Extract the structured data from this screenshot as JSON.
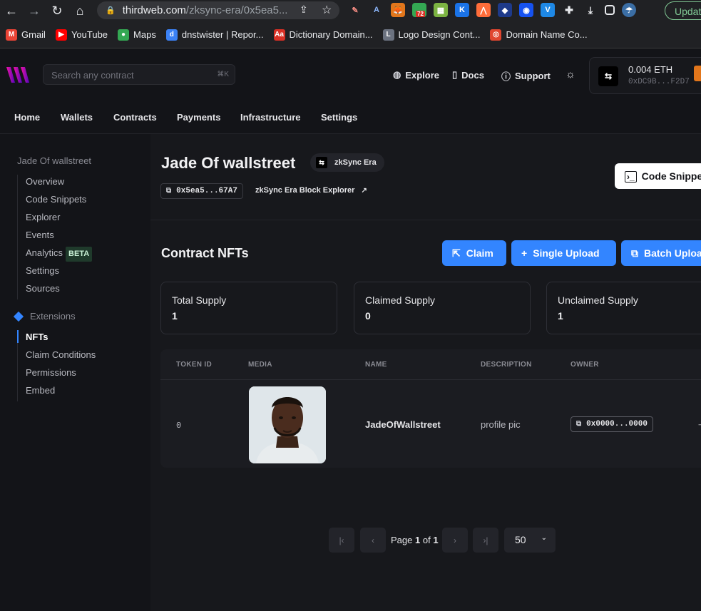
{
  "browser": {
    "url_host": "thirdweb.com",
    "url_path": "/zksync-era/0x5ea5...",
    "update_label": "Update",
    "extension_badge": "72",
    "bookmarks": [
      {
        "label": "Gmail",
        "color": "#ea4335",
        "glyph": "M"
      },
      {
        "label": "YouTube",
        "color": "#ff0000",
        "glyph": "▶"
      },
      {
        "label": "Maps",
        "color": "#34a853",
        "glyph": "●"
      },
      {
        "label": "dnstwister | Repor...",
        "color": "#3b82f6",
        "glyph": "d"
      },
      {
        "label": "Dictionary Domain...",
        "color": "#d93025",
        "glyph": "Aa"
      },
      {
        "label": "Logo Design Cont...",
        "color": "#6b7280",
        "glyph": "L"
      },
      {
        "label": "Domain Name Co...",
        "color": "#e0462f",
        "glyph": "◎"
      }
    ]
  },
  "header": {
    "search_placeholder": "Search any contract",
    "search_shortcut": "⌘K",
    "explore": "Explore",
    "docs": "Docs",
    "support": "Support",
    "wallet_balance": "0.004 ETH",
    "wallet_address": "0xDC9B...F2D7",
    "wallet_chain_glyph": "⇆"
  },
  "nav": [
    "Home",
    "Wallets",
    "Contracts",
    "Payments",
    "Infrastructure",
    "Settings"
  ],
  "sidebar": {
    "title": "Jade Of wallstreet",
    "items": [
      "Overview",
      "Code Snippets",
      "Explorer",
      "Events",
      "Analytics",
      "Settings",
      "Sources"
    ],
    "beta_badge": "BETA",
    "extensions_label": "Extensions",
    "ext_items": [
      "NFTs",
      "Claim Conditions",
      "Permissions",
      "Embed"
    ],
    "active": "NFTs"
  },
  "contract": {
    "name": "Jade Of wallstreet",
    "chain": "zkSync Era",
    "address": "0x5ea5...67A7",
    "explorer_link": "zkSync Era Block Explorer",
    "code_snippets_label": "Code Snippets"
  },
  "nfts": {
    "title": "Contract NFTs",
    "claim_label": "Claim",
    "single_upload_label": "Single Upload",
    "batch_upload_label": "Batch Upload",
    "stats": [
      {
        "label": "Total Supply",
        "value": "1"
      },
      {
        "label": "Claimed Supply",
        "value": "0"
      },
      {
        "label": "Unclaimed Supply",
        "value": "1"
      }
    ],
    "columns": [
      "TOKEN ID",
      "MEDIA",
      "NAME",
      "DESCRIPTION",
      "OWNER"
    ],
    "rows": [
      {
        "token_id": "0",
        "name": "JadeOfWallstreet",
        "description": "profile pic",
        "owner": "0x0000...0000"
      }
    ]
  },
  "pagination": {
    "page_word": "Page",
    "current": "1",
    "of_word": "of",
    "total": "1",
    "page_size": "50"
  },
  "colors": {
    "accent": "#3385ff",
    "background": "#131418",
    "panel": "#17181c"
  }
}
